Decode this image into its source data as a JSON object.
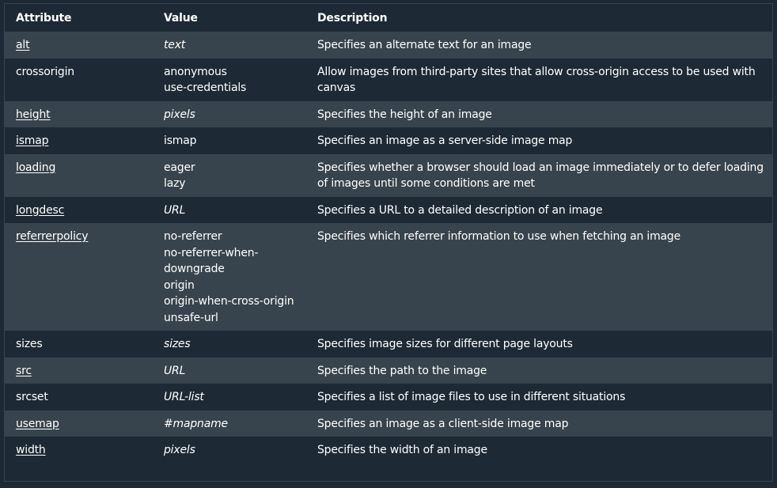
{
  "headers": [
    "Attribute",
    "Value",
    "Description"
  ],
  "rows": [
    {
      "attribute": "alt",
      "link": true,
      "values": [
        "text"
      ],
      "italic": true,
      "description": "Specifies an alternate text for an image"
    },
    {
      "attribute": "crossorigin",
      "link": false,
      "values": [
        "anonymous",
        "use-credentials"
      ],
      "italic": false,
      "description": "Allow images from third-party sites that allow cross-origin access to be used with canvas"
    },
    {
      "attribute": "height",
      "link": true,
      "values": [
        "pixels"
      ],
      "italic": true,
      "description": "Specifies the height of an image"
    },
    {
      "attribute": "ismap",
      "link": true,
      "values": [
        "ismap"
      ],
      "italic": false,
      "description": "Specifies an image as a server-side image map"
    },
    {
      "attribute": "loading",
      "link": true,
      "values": [
        "eager",
        "lazy"
      ],
      "italic": false,
      "description": "Specifies whether a browser should load an image immediately or to defer loading of images until some conditions are met"
    },
    {
      "attribute": "longdesc",
      "link": true,
      "values": [
        "URL"
      ],
      "italic": true,
      "description": "Specifies a URL to a detailed description of an image"
    },
    {
      "attribute": "referrerpolicy",
      "link": true,
      "values": [
        "no-referrer",
        "no-referrer-when-downgrade",
        "origin",
        "origin-when-cross-origin",
        "unsafe-url"
      ],
      "italic": false,
      "description": "Specifies which referrer information to use when fetching an image"
    },
    {
      "attribute": "sizes",
      "link": false,
      "values": [
        "sizes"
      ],
      "italic": true,
      "description": "Specifies image sizes for different page layouts"
    },
    {
      "attribute": "src",
      "link": true,
      "values": [
        "URL"
      ],
      "italic": true,
      "description": "Specifies the path to the image"
    },
    {
      "attribute": "srcset",
      "link": false,
      "values": [
        "URL-list"
      ],
      "italic": true,
      "description": "Specifies a list of image files to use in different situations"
    },
    {
      "attribute": "usemap",
      "link": true,
      "values": [
        "#mapname"
      ],
      "italic": true,
      "description": "Specifies an image as a client-side image map"
    },
    {
      "attribute": "width",
      "link": true,
      "values": [
        "pixels"
      ],
      "italic": true,
      "description": "Specifies the width of an image"
    }
  ]
}
